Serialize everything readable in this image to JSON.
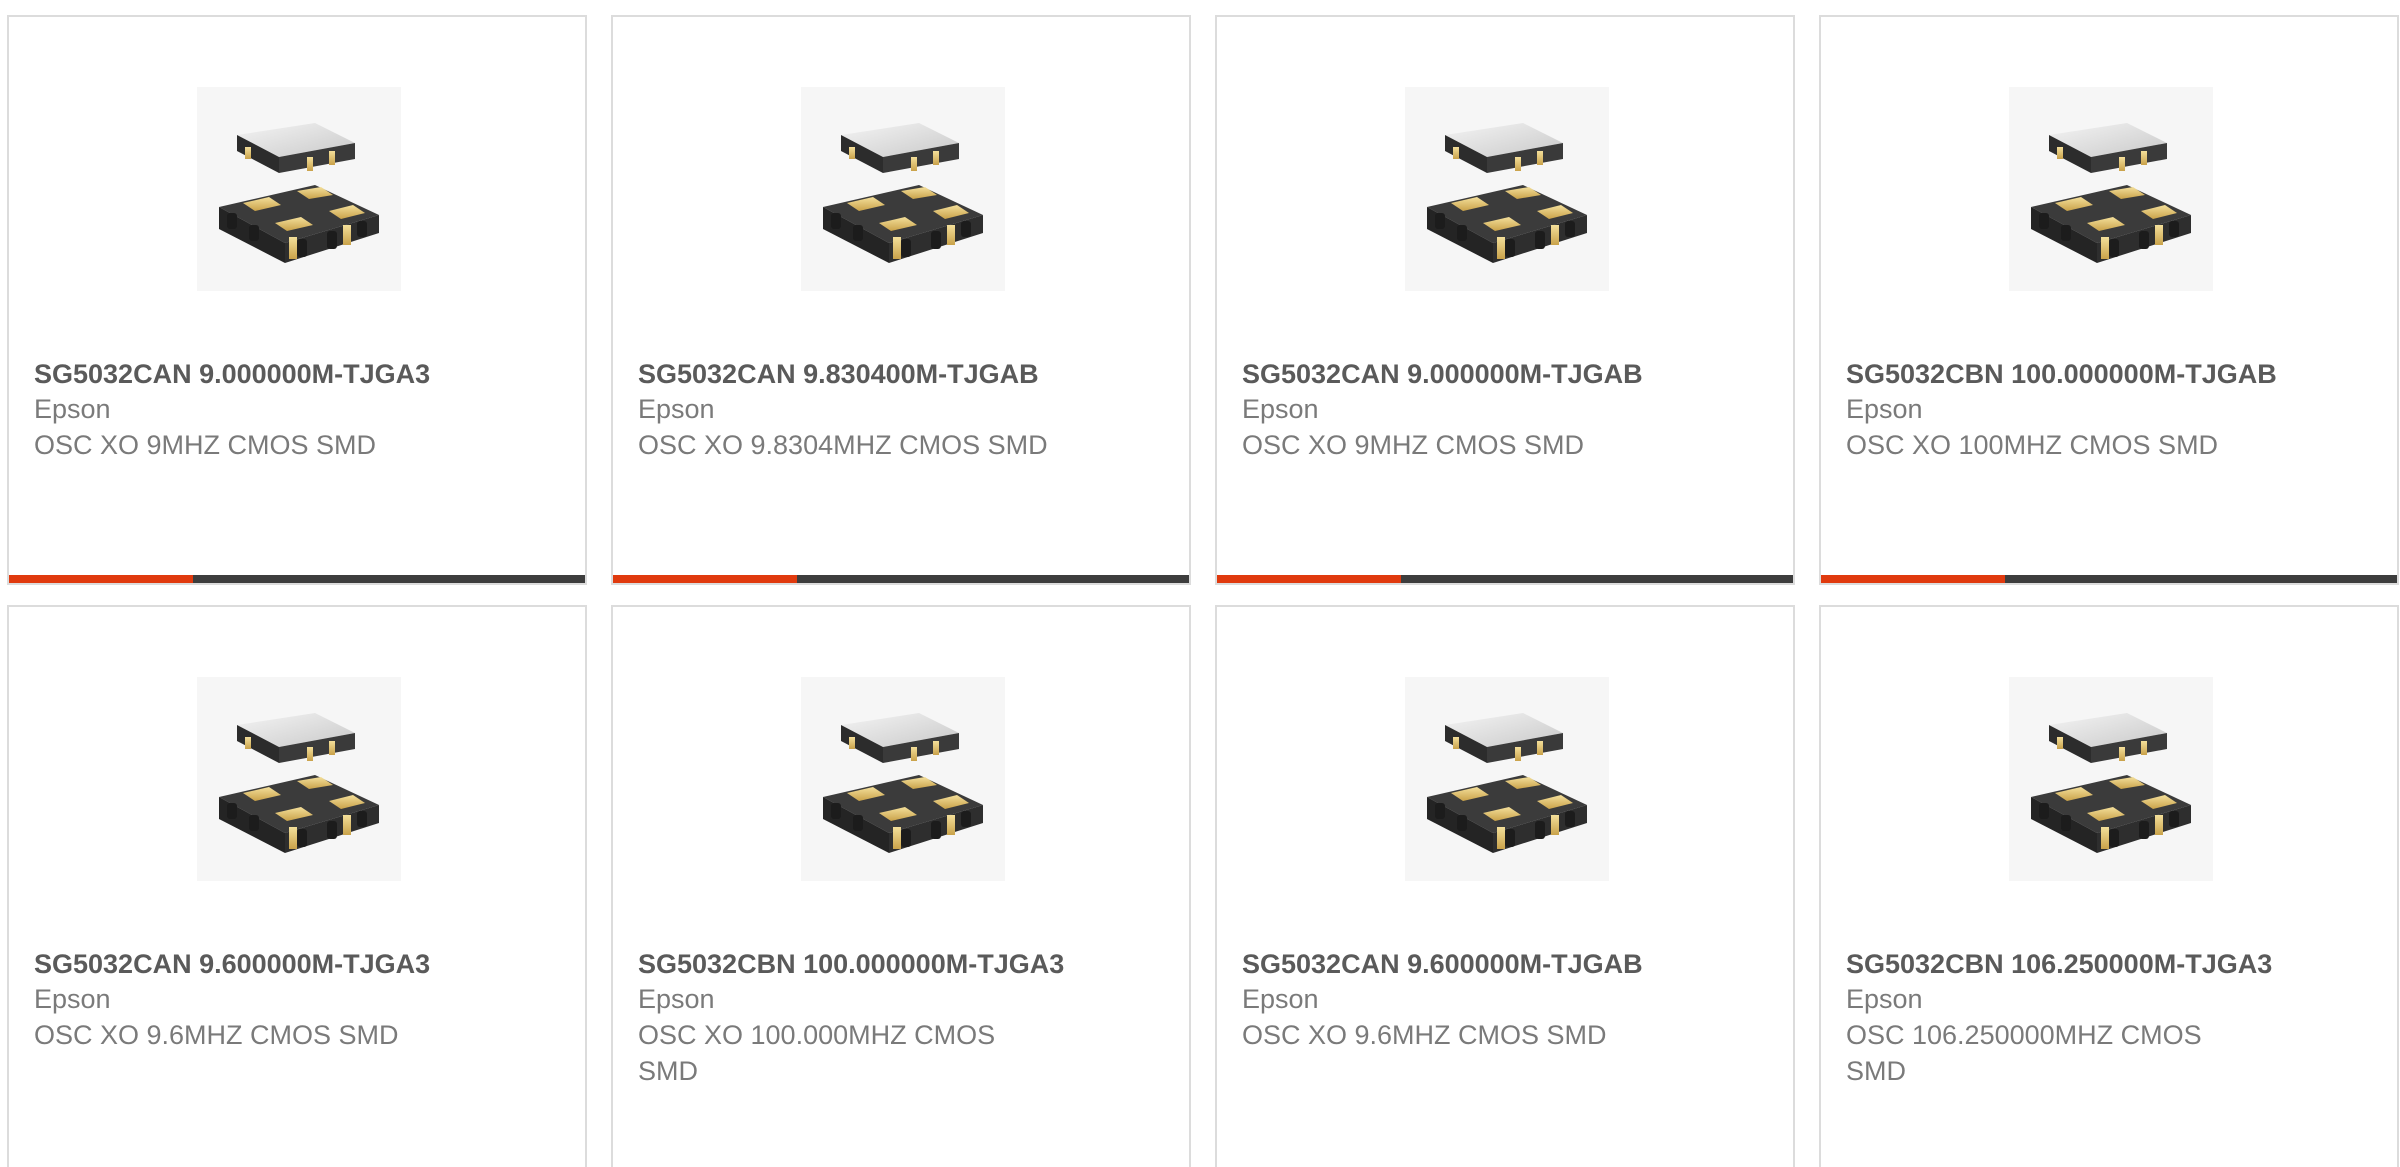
{
  "colors": {
    "accent": "#e03a0e",
    "bar_track": "#3d3d3d",
    "card_border": "#dcdcdc",
    "title_text": "#5a5a5a",
    "body_text": "#7a7a7a"
  },
  "products": [
    {
      "part_number": "SG5032CAN 9.000000M-TJGA3",
      "manufacturer": "Epson",
      "description": "OSC XO 9MHZ CMOS SMD",
      "progress_fraction": 0.32,
      "image_icon": "oscillator-chip-image"
    },
    {
      "part_number": "SG5032CAN 9.830400M-TJGAB",
      "manufacturer": "Epson",
      "description": "OSC XO 9.8304MHZ CMOS SMD",
      "progress_fraction": 0.32,
      "image_icon": "oscillator-chip-image"
    },
    {
      "part_number": "SG5032CAN 9.000000M-TJGAB",
      "manufacturer": "Epson",
      "description": "OSC XO 9MHZ CMOS SMD",
      "progress_fraction": 0.32,
      "image_icon": "oscillator-chip-image"
    },
    {
      "part_number": "SG5032CBN 100.000000M-TJGAB",
      "manufacturer": "Epson",
      "description": "OSC XO 100MHZ CMOS SMD",
      "progress_fraction": 0.32,
      "image_icon": "oscillator-chip-image"
    },
    {
      "part_number": "SG5032CAN 9.600000M-TJGA3",
      "manufacturer": "Epson",
      "description": "OSC XO 9.6MHZ CMOS SMD",
      "image_icon": "oscillator-chip-image"
    },
    {
      "part_number": "SG5032CBN 100.000000M-TJGA3",
      "manufacturer": "Epson",
      "description": "OSC XO 100.000MHZ CMOS SMD",
      "image_icon": "oscillator-chip-image"
    },
    {
      "part_number": "SG5032CAN 9.600000M-TJGAB",
      "manufacturer": "Epson",
      "description": "OSC XO 9.6MHZ CMOS SMD",
      "image_icon": "oscillator-chip-image"
    },
    {
      "part_number": "SG5032CBN 106.250000M-TJGA3",
      "manufacturer": "Epson",
      "description": "OSC 106.250000MHZ CMOS SMD",
      "image_icon": "oscillator-chip-image"
    }
  ]
}
